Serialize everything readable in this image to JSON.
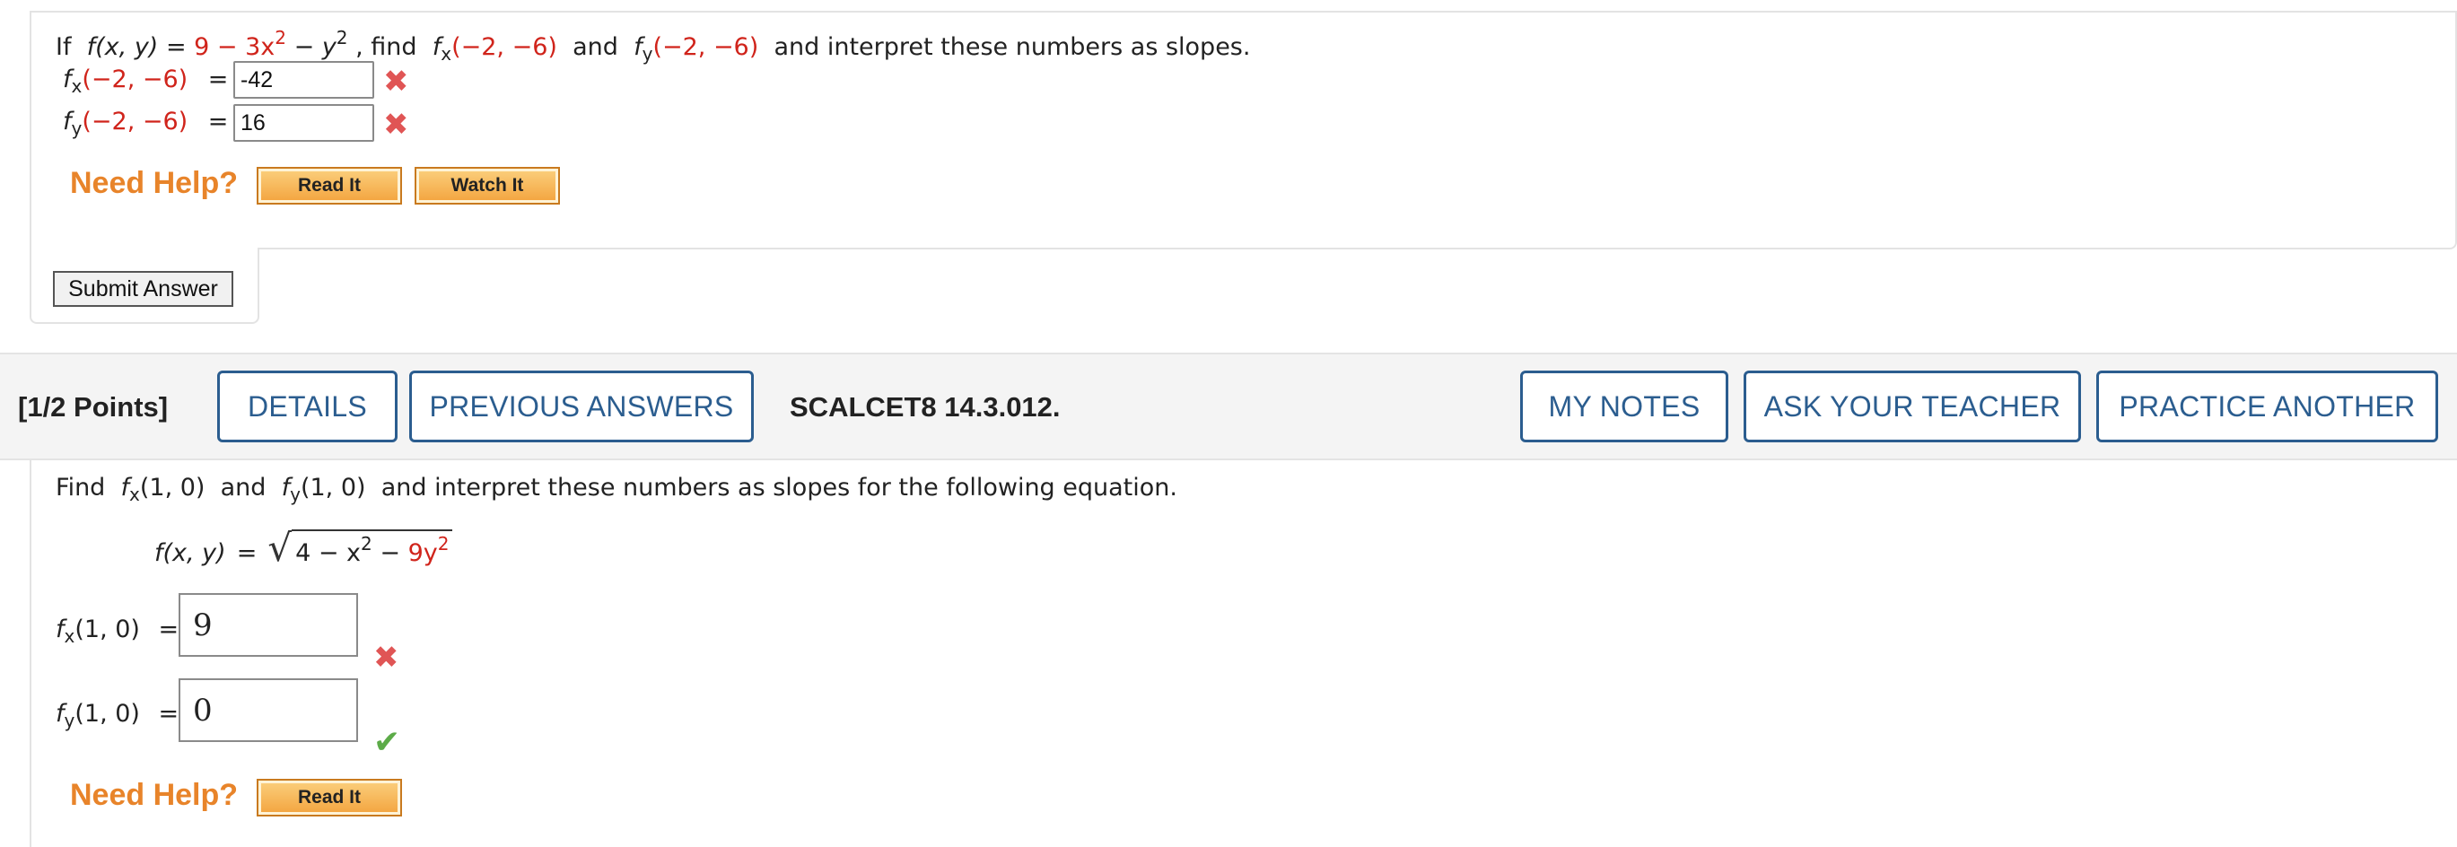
{
  "q1": {
    "prompt": {
      "if": "If",
      "f_of": "f(x, y)",
      "eq": "=",
      "expr_red": "9 − 3x",
      "sq1": "2",
      "minus_y": "− y",
      "sq2": "2",
      "find": ", find",
      "fx": "f",
      "x_sub": "x",
      "fx_args": "(−2, −6)",
      "and": "and",
      "fy": "f",
      "y_sub": "y",
      "fy_args": "(−2, −6)",
      "tail": "and interpret these numbers as slopes."
    },
    "rows": [
      {
        "fn": "f",
        "sub": "x",
        "args": "(−2, −6)",
        "eq": "=",
        "value": "-42",
        "status": "incorrect"
      },
      {
        "fn": "f",
        "sub": "y",
        "args": "(−2, −6)",
        "eq": "=",
        "value": "16",
        "status": "incorrect"
      }
    ],
    "need_help": "Need Help?",
    "read_it": "Read It",
    "watch_it": "Watch It",
    "submit": "Submit Answer"
  },
  "q2": {
    "points": "[1/2 Points]",
    "details": "DETAILS",
    "previous_answers": "PREVIOUS ANSWERS",
    "reference": "SCALCET8 14.3.012.",
    "my_notes": "MY NOTES",
    "ask_teacher": "ASK YOUR TEACHER",
    "practice_another": "PRACTICE ANOTHER",
    "prompt": {
      "find": "Find",
      "fx": "f",
      "x_sub": "x",
      "fx_args": "(1, 0)",
      "and": "and",
      "fy": "f",
      "y_sub": "y",
      "fy_args": "(1, 0)",
      "tail": "and interpret these numbers as slopes for the following equation."
    },
    "equation": {
      "lhs": "f(x, y)",
      "eq": "=",
      "rad_black": "4 − x",
      "sq1": "2",
      "minus": " − ",
      "rad_red": "9y",
      "sq2": "2"
    },
    "rows": [
      {
        "fn": "f",
        "sub": "x",
        "args": "(1, 0)",
        "eq": "=",
        "value": "9",
        "status": "incorrect"
      },
      {
        "fn": "f",
        "sub": "y",
        "args": "(1, 0)",
        "eq": "=",
        "value": "0",
        "status": "correct"
      }
    ],
    "need_help": "Need Help?",
    "read_it": "Read It"
  },
  "colors": {
    "accent_blue": "#2b5d8f",
    "red_math": "#d0241b",
    "help_orange": "#e8842a",
    "incorrect": "#e05555",
    "correct": "#5cab48"
  },
  "icons": {
    "incorrect": "x-mark-icon",
    "correct": "check-mark-icon"
  }
}
